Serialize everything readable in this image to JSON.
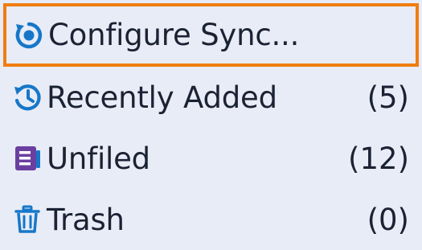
{
  "menu": {
    "items": [
      {
        "label": "Configure Sync...",
        "count": "",
        "icon": "sync-icon",
        "highlighted": true
      },
      {
        "label": "Recently Added",
        "count": "(5)",
        "icon": "history-icon"
      },
      {
        "label": "Unfiled",
        "count": "(12)",
        "icon": "unfiled-icon"
      },
      {
        "label": "Trash",
        "count": "(0)",
        "icon": "trash-icon"
      }
    ]
  },
  "colors": {
    "background": "#e8ecf6",
    "highlight_border": "#f07d10",
    "icon_blue": "#1677c9",
    "icon_purple": "#6b3fa0",
    "text": "#1a2233"
  }
}
